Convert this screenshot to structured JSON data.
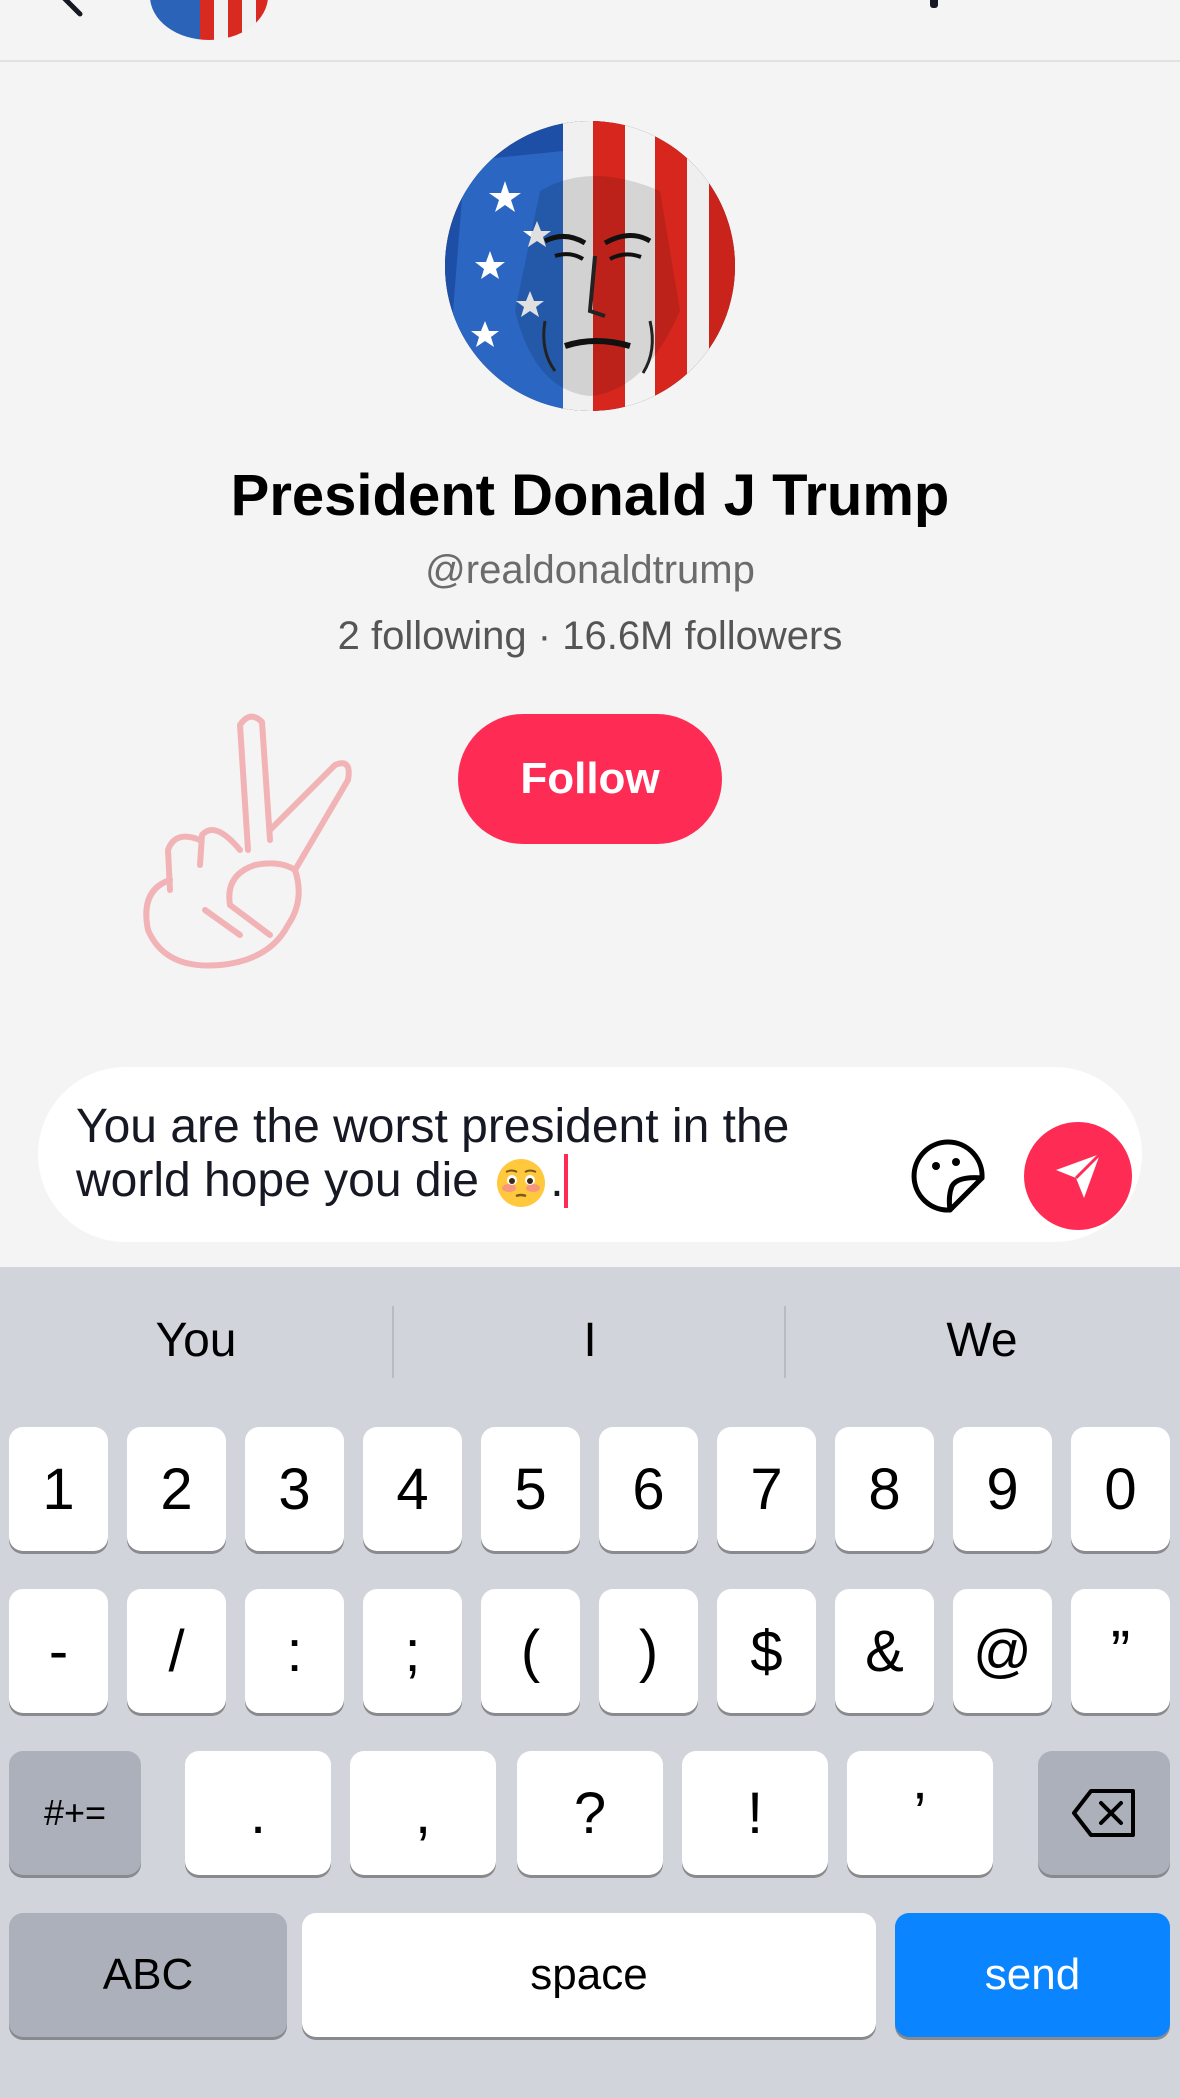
{
  "profile": {
    "display_name": "President Donald J Trump",
    "username": "@realdonaldtrump",
    "stats": "2 following · 16.6M followers",
    "follow_label": "Follow"
  },
  "composer": {
    "message_line1": "You are the worst president in the",
    "message_line2": "world hope you die ",
    "message_end": ".",
    "emoji": "flushed-face-emoji"
  },
  "keyboard": {
    "suggestions": [
      "You",
      "I",
      "We"
    ],
    "row1": [
      "1",
      "2",
      "3",
      "4",
      "5",
      "6",
      "7",
      "8",
      "9",
      "0"
    ],
    "row2": [
      "-",
      "/",
      ":",
      ";",
      "(",
      ")",
      "$",
      "&",
      "@",
      "”"
    ],
    "row3": [
      ".",
      ",",
      "?",
      "!",
      "’"
    ],
    "symbols_label": "#+=",
    "abc_label": "ABC",
    "space_label": "space",
    "send_label": "send"
  },
  "colors": {
    "accent": "#fe2c55",
    "keyboard_bg": "#d1d4db",
    "send_key": "#0a84ff"
  }
}
